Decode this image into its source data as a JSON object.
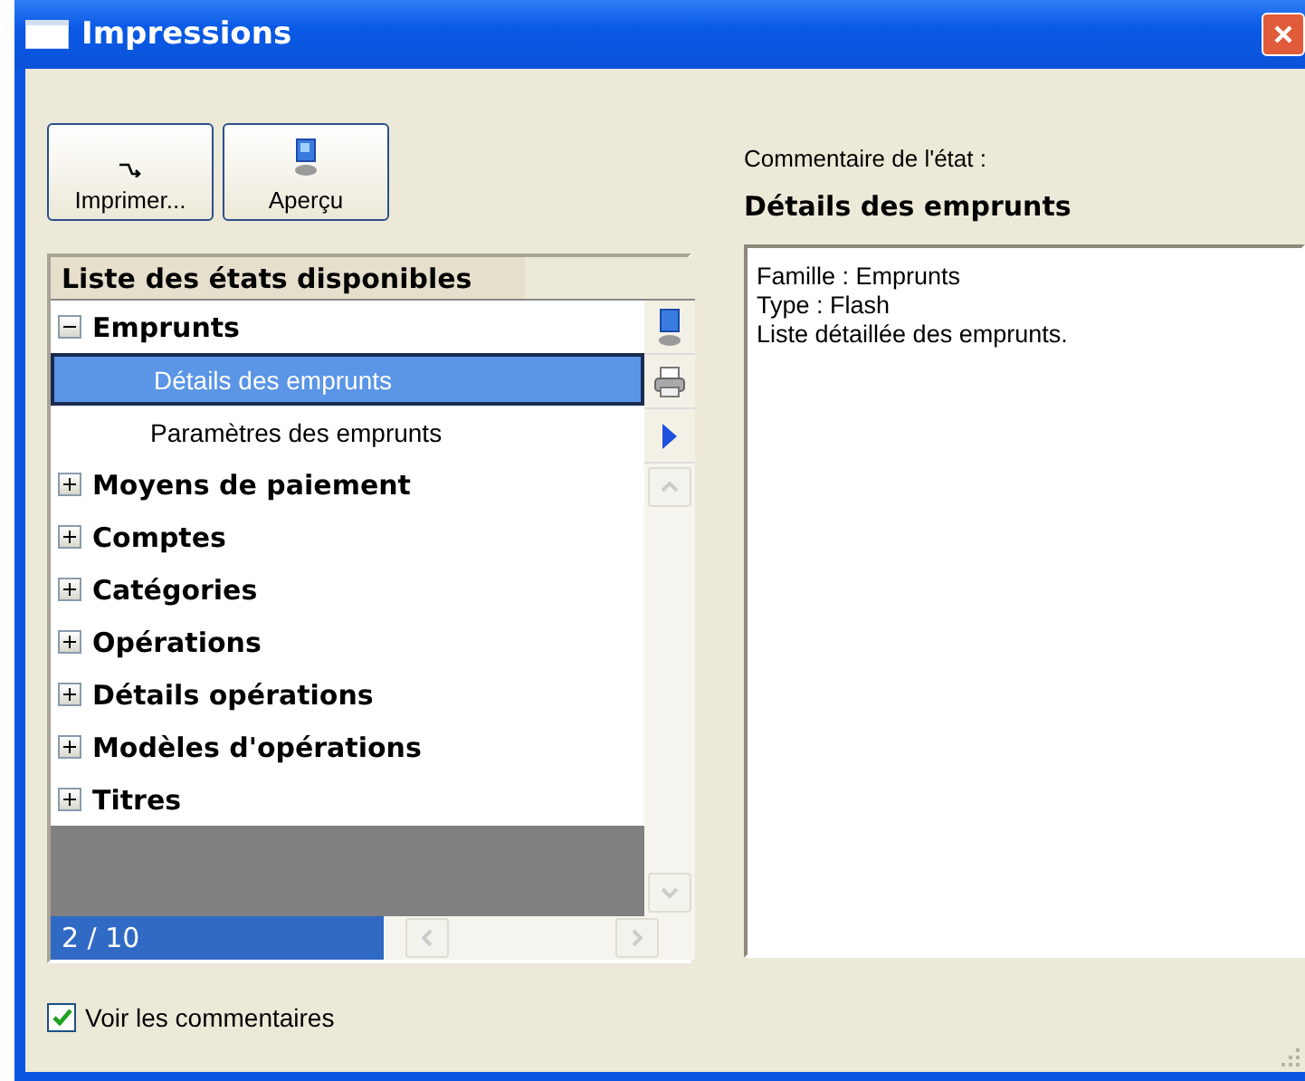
{
  "window": {
    "title": "Impressions"
  },
  "toolbar": [
    {
      "kind": "print",
      "label": "Imprimer..."
    },
    {
      "kind": "preview",
      "label": "Aperçu"
    }
  ],
  "list": {
    "header": "Liste des états disponibles",
    "status": "2 / 10",
    "items": [
      {
        "label": "Emprunts",
        "expanded": true,
        "selected": false,
        "children": [
          {
            "label": "Détails des emprunts",
            "selected": true
          },
          {
            "label": "Paramètres des emprunts",
            "selected": false
          }
        ]
      },
      {
        "label": "Moyens de paiement",
        "expanded": false,
        "selected": false
      },
      {
        "label": "Comptes",
        "expanded": false,
        "selected": false
      },
      {
        "label": "Catégories",
        "expanded": false,
        "selected": false
      },
      {
        "label": "Opérations",
        "expanded": false,
        "selected": false
      },
      {
        "label": "Détails opérations",
        "expanded": false,
        "selected": false
      },
      {
        "label": "Modèles d'opérations",
        "expanded": false,
        "selected": false
      },
      {
        "label": "Titres",
        "expanded": false,
        "selected": false
      }
    ]
  },
  "comment": {
    "label": "Commentaire de l'état :",
    "title": "Détails des emprunts",
    "lines": [
      "Famille : Emprunts",
      "Type : Flash",
      "Liste détaillée des emprunts."
    ]
  },
  "show_comments": {
    "label": "Voir les commentaires",
    "checked": true
  }
}
